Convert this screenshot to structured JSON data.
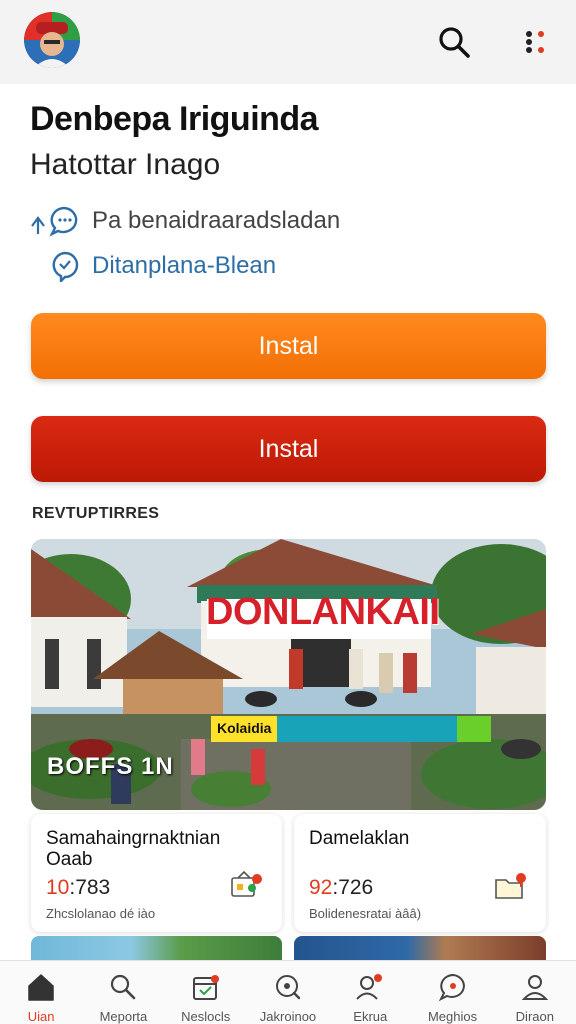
{
  "header": {
    "title": "Denbepa Iriguinda",
    "subtitle": "Hatottar Inago"
  },
  "info": {
    "line1": "Pa benaidraaradsladan",
    "line2": "Ditanplana-Blean"
  },
  "buttons": {
    "install_primary": "Instal",
    "install_secondary": "Instal"
  },
  "section": {
    "label": "REVTUPTIRRES"
  },
  "hero": {
    "sign_text": "DONLANKAII",
    "banner_text": "Kolaidia",
    "caption": "BOFFS 1N"
  },
  "cards": [
    {
      "title": "Samahaingrnaktnian Oaab",
      "value_highlight": "10",
      "value_rest": ":783",
      "note": "Zhcslolanao dé iào"
    },
    {
      "title": "Damelaklan",
      "value_highlight": "92",
      "value_rest": ":726",
      "note": "Bolidenesratai àââ)"
    }
  ],
  "bottom_nav": [
    {
      "label": "Uian",
      "icon": "home-icon",
      "active": true
    },
    {
      "label": "Meporta",
      "icon": "search-icon",
      "active": false
    },
    {
      "label": "Neslocls",
      "icon": "calendar-icon",
      "active": false
    },
    {
      "label": "Jakroinoo",
      "icon": "search-icon",
      "active": false
    },
    {
      "label": "Ekrua",
      "icon": "people-icon",
      "active": false
    },
    {
      "label": "Meghios",
      "icon": "chat-icon",
      "active": false
    },
    {
      "label": "Diraon",
      "icon": "user-icon",
      "active": false
    }
  ],
  "colors": {
    "accent_orange": "#f36f05",
    "accent_red": "#c81e08",
    "link_blue": "#2e6ea6"
  }
}
